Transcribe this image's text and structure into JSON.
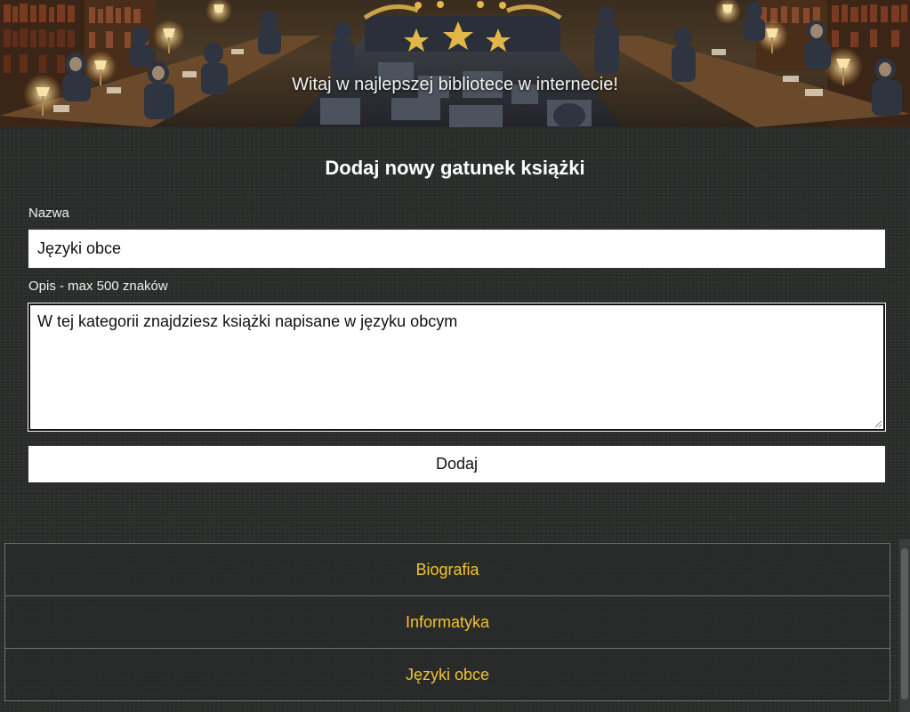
{
  "hero": {
    "welcome_text": "Witaj w najlepszej bibliotece w internecie!"
  },
  "form": {
    "title": "Dodaj nowy gatunek książki",
    "name_label": "Nazwa",
    "name_value": "Języki obce",
    "description_label": "Opis - max 500 znaków",
    "description_value": "W tej kategorii znajdziesz książki napisane w języku obcym",
    "submit_label": "Dodaj"
  },
  "genres": [
    {
      "name": "Biografia"
    },
    {
      "name": "Informatyka"
    },
    {
      "name": "Języki obce"
    }
  ],
  "colors": {
    "genre_link": "#f2c230",
    "background": "#2a2c2b"
  }
}
